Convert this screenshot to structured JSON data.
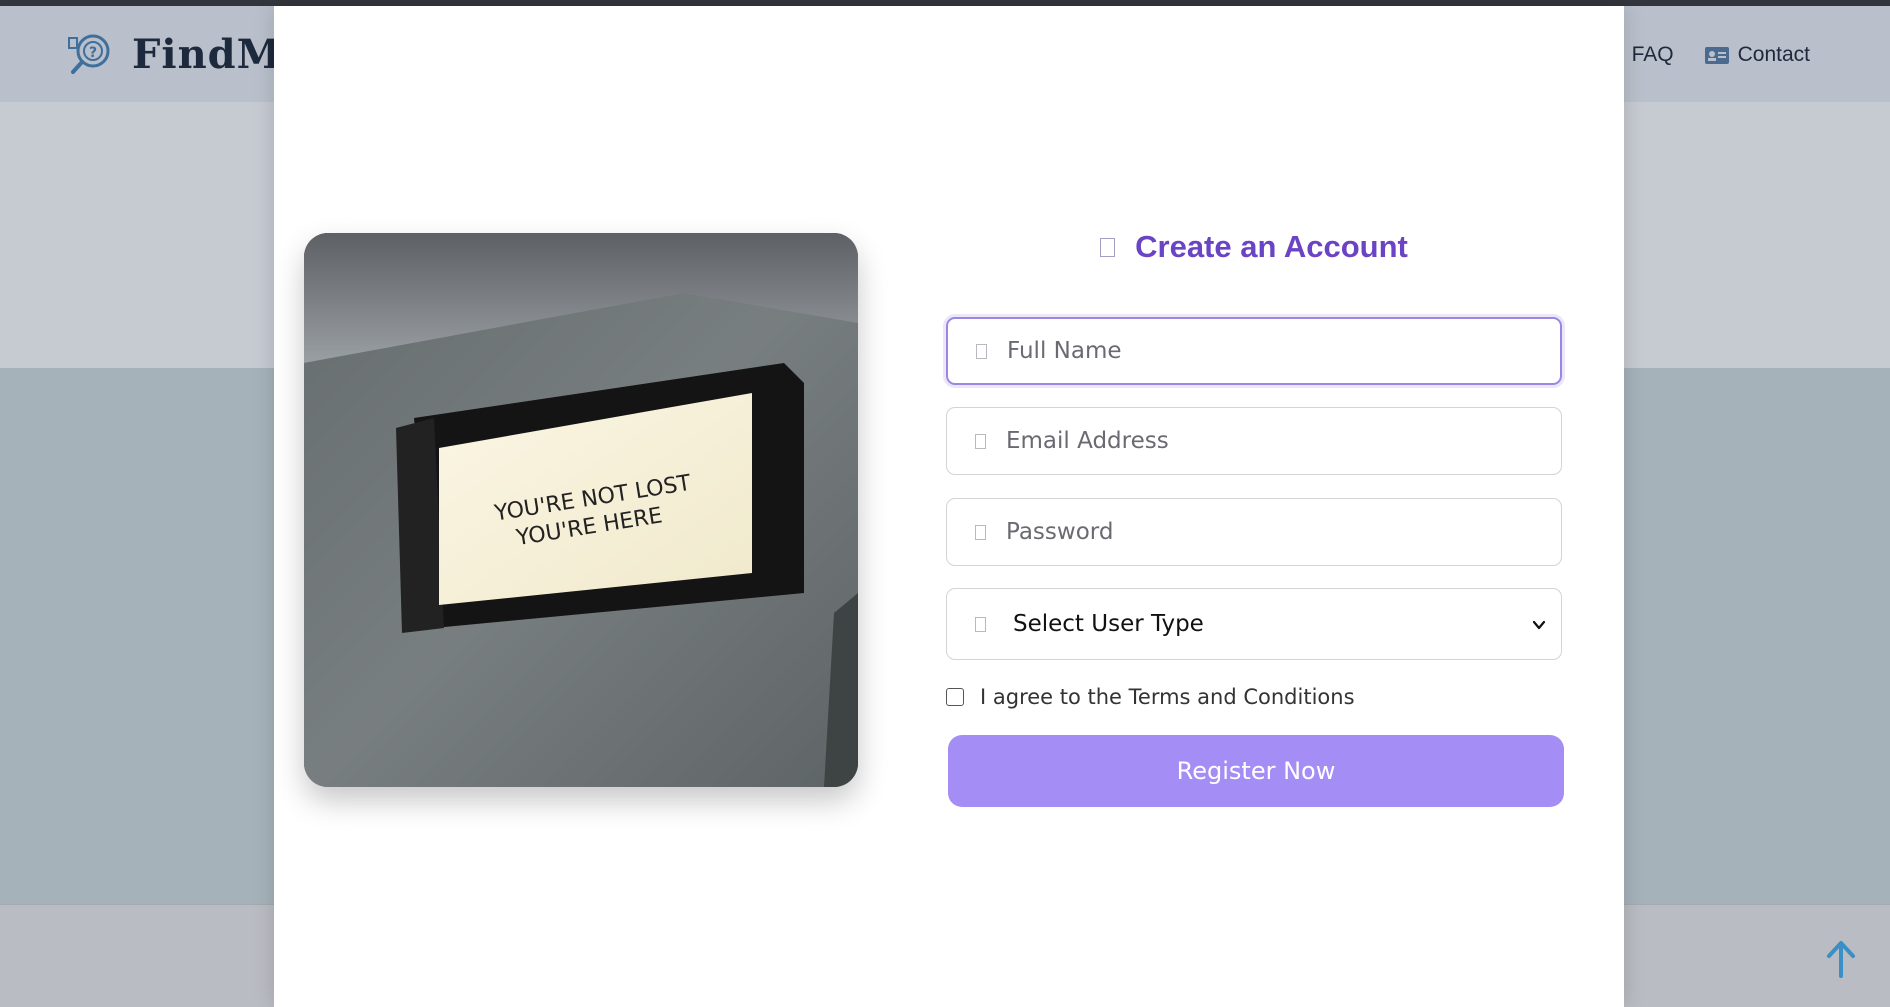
{
  "background": {
    "brand_name": "FindMy",
    "nav": [
      {
        "label": "FAQ",
        "icon": "question-circle-icon"
      },
      {
        "label": "Contact",
        "icon": "contact-card-icon"
      }
    ],
    "back_to_top_icon": "arrow-up-icon"
  },
  "modal": {
    "image": {
      "sign_line1": "YOU'RE NOT LOST",
      "sign_line2": "YOU'RE HERE"
    },
    "form": {
      "title": "Create an Account",
      "title_icon": "user-plus-icon",
      "full_name": {
        "placeholder": "Full Name",
        "value": "",
        "icon": "user-icon"
      },
      "email": {
        "placeholder": "Email Address",
        "value": "",
        "icon": "envelope-icon"
      },
      "password": {
        "placeholder": "Password",
        "value": "",
        "icon": "lock-icon"
      },
      "user_type": {
        "selected": "Select User Type",
        "icon": "users-icon"
      },
      "terms_label": "I agree to the Terms and Conditions",
      "terms_checked": false,
      "submit_label": "Register Now"
    }
  },
  "colors": {
    "accent": "#6a44c4",
    "button": "#a58df6",
    "back_to_top": "#3a8fc4"
  }
}
